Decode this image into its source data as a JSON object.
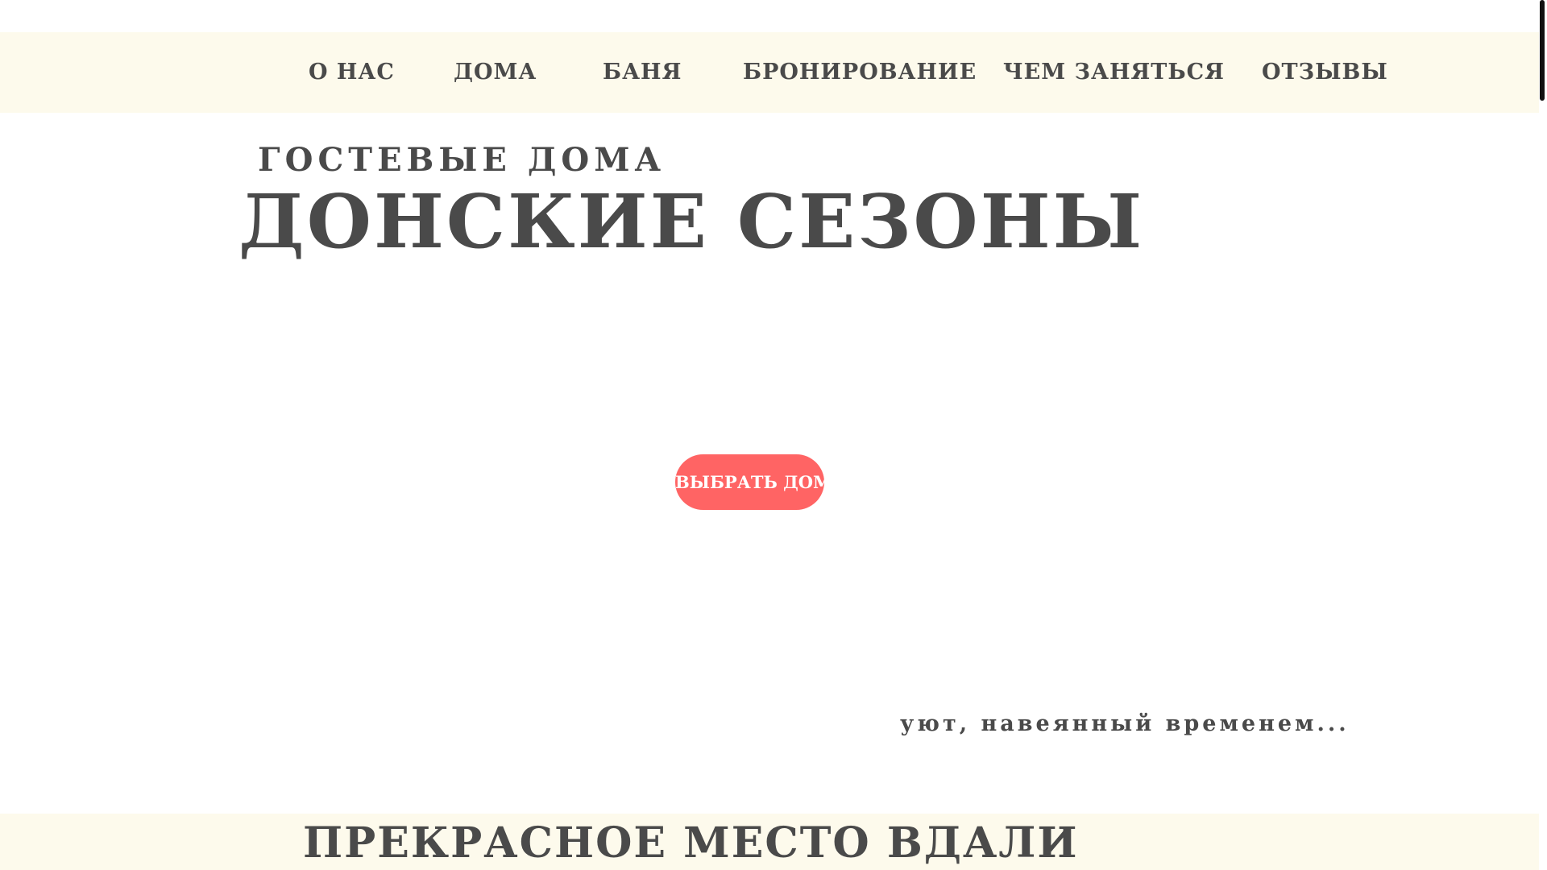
{
  "nav": {
    "items": [
      {
        "label": "О НАС"
      },
      {
        "label": "ДОМА"
      },
      {
        "label": "БАНЯ"
      },
      {
        "label": "БРОНИРОВАНИЕ"
      },
      {
        "label": "ЧЕМ ЗАНЯТЬСЯ"
      },
      {
        "label": "ОТЗЫВЫ"
      }
    ]
  },
  "hero": {
    "subtitle": "ГОСТЕВЫЕ ДОМА",
    "title": "ДОНСКИЕ СЕЗОНЫ",
    "cta_label": "ВЫБРАТЬ ДОМ",
    "tagline": "уют, навеянный временем..."
  },
  "section": {
    "heading": "ПРЕКРАСНОЕ МЕСТО ВДАЛИ"
  },
  "colors": {
    "nav_background": "#fdfaec",
    "text": "#4a4a4a",
    "cta_background": "#ff6464",
    "cta_text": "#ffffff"
  }
}
